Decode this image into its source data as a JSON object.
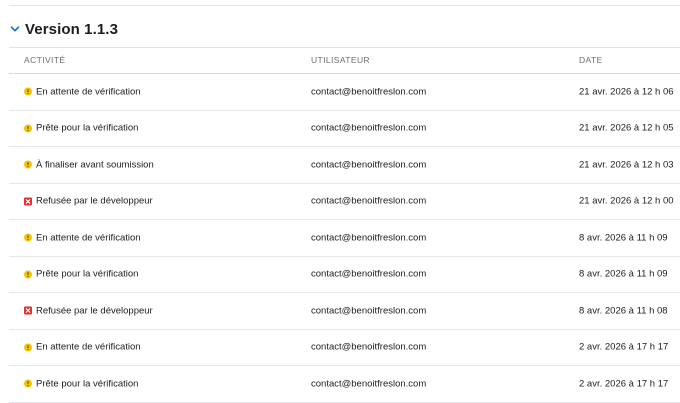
{
  "version": {
    "title": "Version 1.1.3",
    "expanded": true
  },
  "table": {
    "headers": {
      "activity": "ACTIVITÉ",
      "user": "UTILISATEUR",
      "date": "DATE"
    },
    "rows": [
      {
        "status": "pending",
        "activity": "En attente de vérification",
        "user": "contact@benoitfreslon.com",
        "date": "21 avr. 2026 à 12 h 06"
      },
      {
        "status": "pending",
        "activity": "Prête pour la vérification",
        "user": "contact@benoitfreslon.com",
        "date": "21 avr. 2026 à 12 h 05"
      },
      {
        "status": "pending",
        "activity": "À finaliser avant soumission",
        "user": "contact@benoitfreslon.com",
        "date": "21 avr. 2026 à 12 h 03"
      },
      {
        "status": "rejected",
        "activity": "Refusée par le développeur",
        "user": "contact@benoitfreslon.com",
        "date": "21 avr. 2026 à 12 h 00"
      },
      {
        "status": "pending",
        "activity": "En attente de vérification",
        "user": "contact@benoitfreslon.com",
        "date": "8 avr. 2026 à 11 h 09"
      },
      {
        "status": "pending",
        "activity": "Prête pour la vérification",
        "user": "contact@benoitfreslon.com",
        "date": "8 avr. 2026 à 11 h 09"
      },
      {
        "status": "rejected",
        "activity": "Refusée par le développeur",
        "user": "contact@benoitfreslon.com",
        "date": "8 avr. 2026 à 11 h 08"
      },
      {
        "status": "pending",
        "activity": "En attente de vérification",
        "user": "contact@benoitfreslon.com",
        "date": "2 avr. 2026 à 17 h 17"
      },
      {
        "status": "pending",
        "activity": "Prête pour la vérification",
        "user": "contact@benoitfreslon.com",
        "date": "2 avr. 2026 à 17 h 17"
      }
    ]
  },
  "icons": {
    "pending": "warning-circle-icon",
    "rejected": "rejected-x-icon",
    "chevron": "chevron-down-icon"
  },
  "colors": {
    "pending": "#f5c400",
    "rejected": "#e0302a",
    "accent": "#0071e3"
  }
}
